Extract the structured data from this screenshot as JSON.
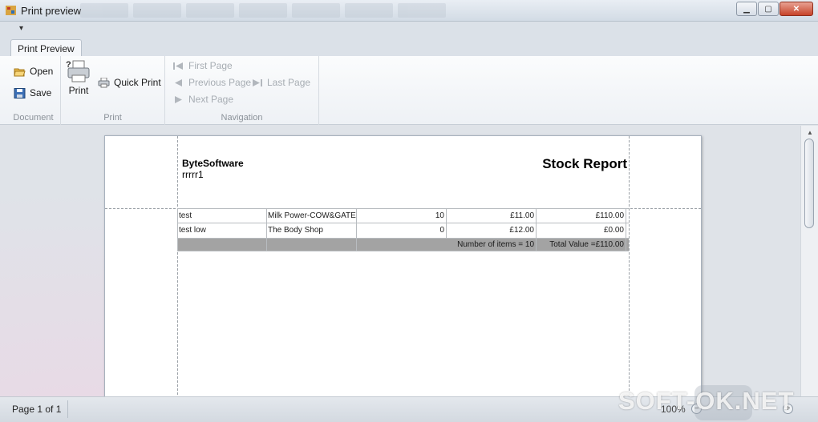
{
  "window": {
    "title": "Print preview"
  },
  "quick_access": {
    "dropdown_label": "▾"
  },
  "ribbon": {
    "active_tab": "Print Preview",
    "groups": {
      "document": {
        "label": "Document",
        "open": "Open",
        "save": "Save"
      },
      "print": {
        "label": "Print",
        "print": "Print",
        "quick_print": "Quick Print"
      },
      "navigation": {
        "label": "Navigation",
        "first_page": "First Page",
        "previous_page": "Previous Page",
        "next_page": "Next  Page",
        "last_page": "Last  Page"
      }
    }
  },
  "report": {
    "company": "ByteSoftware",
    "subtitle": "rrrrr1",
    "title": "Stock Report",
    "rows": [
      {
        "c1": "test",
        "c2": "Milk Power-COW&GATE",
        "c3": "10",
        "c4": "£11.00",
        "c5": "£110.00"
      },
      {
        "c1": "test low",
        "c2": "The Body Shop",
        "c3": "0",
        "c4": "£12.00",
        "c5": "£0.00"
      }
    ],
    "totals": {
      "items": "Number of items = 10",
      "value": "Total Value =£110.00"
    }
  },
  "status": {
    "page": "Page 1 of 1",
    "zoom": "100%"
  },
  "watermark": "SOFT-OK.NET",
  "colors": {
    "window_bg": "#dfe3e8",
    "total_row": "#a3a3a3",
    "close_button": "#c7432a"
  }
}
